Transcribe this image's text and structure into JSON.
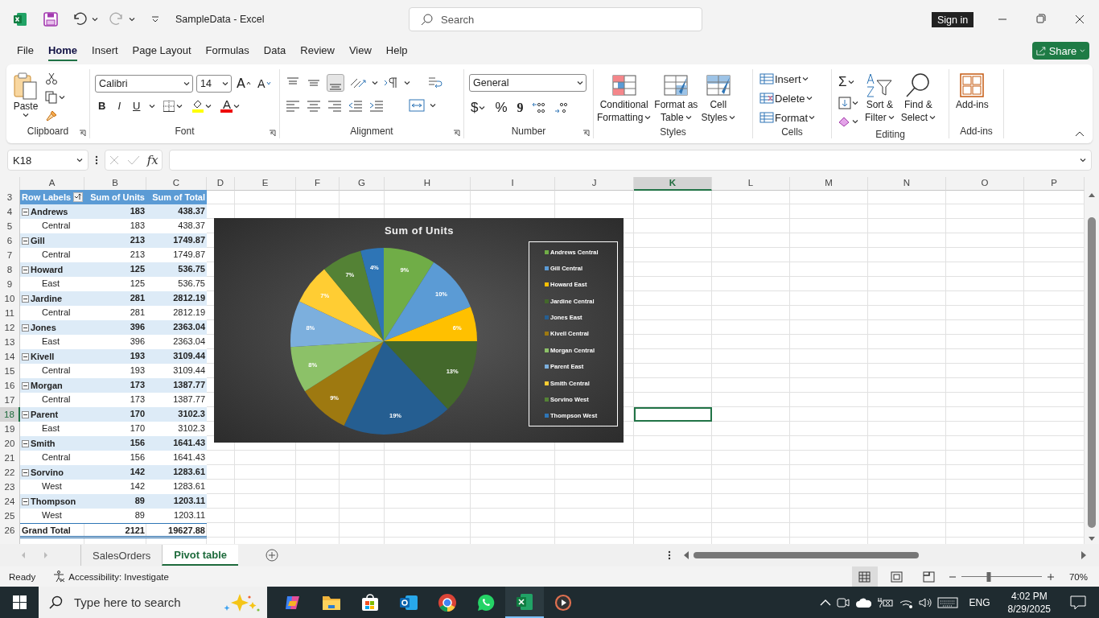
{
  "window": {
    "title": "SampleData  -  Excel",
    "search_placeholder": "Search",
    "sign_in": "Sign in"
  },
  "menu_tabs": [
    {
      "label": "File",
      "selected": false
    },
    {
      "label": "Home",
      "selected": true
    },
    {
      "label": "Insert",
      "selected": false
    },
    {
      "label": "Page Layout",
      "selected": false
    },
    {
      "label": "Formulas",
      "selected": false
    },
    {
      "label": "Data",
      "selected": false
    },
    {
      "label": "Review",
      "selected": false
    },
    {
      "label": "View",
      "selected": false
    },
    {
      "label": "Help",
      "selected": false
    }
  ],
  "share": "Share",
  "ribbon": {
    "paste": "Paste",
    "font": "Calibri",
    "font_size": "14",
    "grow_font": "A",
    "shrink_font": "A",
    "bold": "B",
    "italic": "I",
    "underline": "U",
    "font_color": "A",
    "number_format": "General",
    "currency": "$",
    "percent": "%",
    "comma": "9",
    "styles": [
      {
        "lines": [
          "Conditional",
          "Formatting"
        ]
      },
      {
        "lines": [
          "Format as",
          "Table"
        ]
      },
      {
        "lines": [
          "Cell",
          "Styles"
        ]
      }
    ],
    "cells": [
      "Insert",
      "Delete",
      "Format"
    ],
    "autosum": "Σ",
    "editing": [
      {
        "lines": [
          "Sort &",
          "Filter"
        ]
      },
      {
        "lines": [
          "Find &",
          "Select"
        ]
      }
    ],
    "addins": "Add-ins",
    "groups": [
      {
        "name": "Clipboard",
        "launcher": true
      },
      {
        "name": "Font",
        "launcher": true
      },
      {
        "name": "Alignment",
        "launcher": true
      },
      {
        "name": "Number",
        "launcher": true
      },
      {
        "name": "Styles",
        "launcher": false
      },
      {
        "name": "Cells",
        "launcher": false
      },
      {
        "name": "Editing",
        "launcher": false
      },
      {
        "name": "Add-ins",
        "launcher": false
      }
    ]
  },
  "formula_bar": {
    "name_box": "K18",
    "fx": "fx"
  },
  "columns": [
    {
      "label": "A",
      "selected": false
    },
    {
      "label": "B",
      "selected": false
    },
    {
      "label": "C",
      "selected": false
    },
    {
      "label": "D",
      "selected": false
    },
    {
      "label": "E",
      "selected": false
    },
    {
      "label": "F",
      "selected": false
    },
    {
      "label": "G",
      "selected": false
    },
    {
      "label": "H",
      "selected": false
    },
    {
      "label": "I",
      "selected": false
    },
    {
      "label": "J",
      "selected": false
    },
    {
      "label": "K",
      "selected": true
    },
    {
      "label": "L",
      "selected": false
    },
    {
      "label": "M",
      "selected": false
    },
    {
      "label": "N",
      "selected": false
    },
    {
      "label": "O",
      "selected": false
    },
    {
      "label": "P",
      "selected": false
    }
  ],
  "rows": [
    {
      "label": "3",
      "selected": false
    },
    {
      "label": "4",
      "selected": false
    },
    {
      "label": "5",
      "selected": false
    },
    {
      "label": "6",
      "selected": false
    },
    {
      "label": "7",
      "selected": false
    },
    {
      "label": "8",
      "selected": false
    },
    {
      "label": "9",
      "selected": false
    },
    {
      "label": "10",
      "selected": false
    },
    {
      "label": "11",
      "selected": false
    },
    {
      "label": "12",
      "selected": false
    },
    {
      "label": "13",
      "selected": false
    },
    {
      "label": "14",
      "selected": false
    },
    {
      "label": "15",
      "selected": false
    },
    {
      "label": "16",
      "selected": false
    },
    {
      "label": "17",
      "selected": false
    },
    {
      "label": "18",
      "selected": true
    },
    {
      "label": "19",
      "selected": false
    },
    {
      "label": "20",
      "selected": false
    },
    {
      "label": "21",
      "selected": false
    },
    {
      "label": "22",
      "selected": false
    },
    {
      "label": "23",
      "selected": false
    },
    {
      "label": "24",
      "selected": false
    },
    {
      "label": "25",
      "selected": false
    },
    {
      "label": "26",
      "selected": false
    }
  ],
  "pivot": {
    "header": [
      "Row Labels",
      "Sum of Units",
      "Sum of Total"
    ],
    "rows": [
      {
        "kind": "group",
        "expanded": true,
        "label": "Andrews",
        "units": "183",
        "total": "438.37"
      },
      {
        "kind": "item",
        "label": "Central",
        "units": "183",
        "total": "438.37"
      },
      {
        "kind": "group",
        "expanded": true,
        "label": "Gill",
        "units": "213",
        "total": "1749.87"
      },
      {
        "kind": "item",
        "label": "Central",
        "units": "213",
        "total": "1749.87"
      },
      {
        "kind": "group",
        "expanded": true,
        "label": "Howard",
        "units": "125",
        "total": "536.75"
      },
      {
        "kind": "item",
        "label": "East",
        "units": "125",
        "total": "536.75"
      },
      {
        "kind": "group",
        "expanded": true,
        "label": "Jardine",
        "units": "281",
        "total": "2812.19"
      },
      {
        "kind": "item",
        "label": "Central",
        "units": "281",
        "total": "2812.19"
      },
      {
        "kind": "group",
        "expanded": true,
        "label": "Jones",
        "units": "396",
        "total": "2363.04"
      },
      {
        "kind": "item",
        "label": "East",
        "units": "396",
        "total": "2363.04"
      },
      {
        "kind": "group",
        "expanded": true,
        "label": "Kivell",
        "units": "193",
        "total": "3109.44"
      },
      {
        "kind": "item",
        "label": "Central",
        "units": "193",
        "total": "3109.44"
      },
      {
        "kind": "group",
        "expanded": true,
        "label": "Morgan",
        "units": "173",
        "total": "1387.77"
      },
      {
        "kind": "item",
        "label": "Central",
        "units": "173",
        "total": "1387.77"
      },
      {
        "kind": "group",
        "expanded": true,
        "label": "Parent",
        "units": "170",
        "total": "3102.3"
      },
      {
        "kind": "item",
        "label": "East",
        "units": "170",
        "total": "3102.3"
      },
      {
        "kind": "group",
        "expanded": true,
        "label": "Smith",
        "units": "156",
        "total": "1641.43"
      },
      {
        "kind": "item",
        "label": "Central",
        "units": "156",
        "total": "1641.43"
      },
      {
        "kind": "group",
        "expanded": true,
        "label": "Sorvino",
        "units": "142",
        "total": "1283.61"
      },
      {
        "kind": "item",
        "label": "West",
        "units": "142",
        "total": "1283.61"
      },
      {
        "kind": "group",
        "expanded": true,
        "label": "Thompson",
        "units": "89",
        "total": "1203.11"
      },
      {
        "kind": "item",
        "label": "West",
        "units": "89",
        "total": "1203.11"
      },
      {
        "kind": "total",
        "label": "Grand Total",
        "units": "2121",
        "total": "19627.88"
      }
    ]
  },
  "chart": {
    "chart_data": {
      "type": "pie",
      "title": "Sum of Units",
      "legend": "right",
      "categories": [
        "Andrews Central",
        "Gill Central",
        "Howard East",
        "Jardine Central",
        "Jones East",
        "Kivell Central",
        "Morgan Central",
        "Parent East",
        "Smith Central",
        "Sorvino West",
        "Thompson West"
      ],
      "values": [
        9,
        10,
        6,
        13,
        19,
        9,
        8,
        8,
        7,
        7,
        4
      ],
      "colors": [
        "#70ad47",
        "#5b9bd5",
        "#ffc000",
        "#43682b",
        "#255e91",
        "#9e7910",
        "#8cc168",
        "#7cafdd",
        "#ffcd33",
        "#548235",
        "#2e75b6"
      ],
      "value_labels": [
        "9%",
        "10%",
        "6%",
        "13%",
        "19%",
        "9%",
        "8%",
        "8%",
        "7%",
        "7%",
        "4%"
      ]
    }
  },
  "sheet_tabs": [
    {
      "label": "SalesOrders",
      "selected": false
    },
    {
      "label": "Pivot table",
      "selected": true
    }
  ],
  "status_bar": {
    "ready": "Ready",
    "accessibility": "Accessibility: Investigate",
    "zoom": "70%",
    "zoom_level": {
      "level": 0.34
    },
    "views": [
      {
        "kind": "normal",
        "selected": true
      },
      {
        "kind": "page_layout",
        "selected": false
      },
      {
        "kind": "page_break",
        "selected": false
      }
    ]
  },
  "taskbar": {
    "search_placeholder": "Type here to search",
    "language": "ENG",
    "time": "4:02 PM",
    "date": "8/29/2025"
  }
}
